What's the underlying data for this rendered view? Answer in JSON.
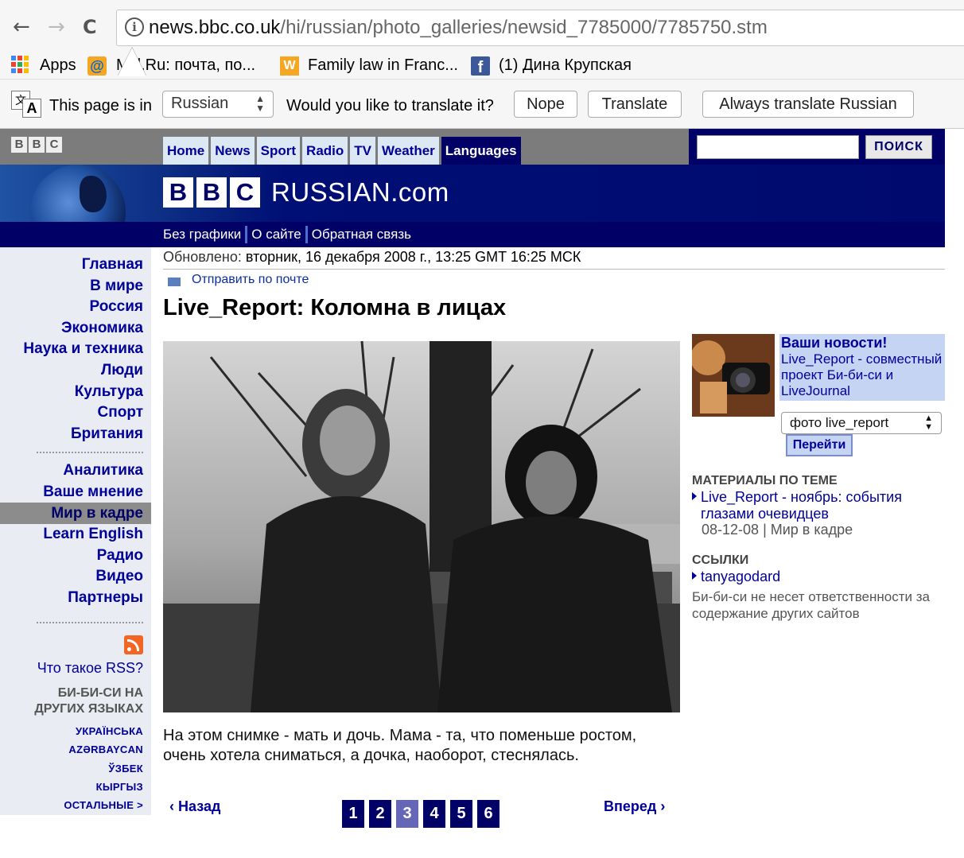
{
  "browser": {
    "back_glyph": "←",
    "forward_glyph": "→",
    "reload_glyph": "C",
    "info_glyph": "i",
    "url_host": "news.bbc.co.uk",
    "url_path": "/hi/russian/photo_galleries/newsid_7785000/7785750.stm",
    "bookmarks": {
      "apps": "Apps",
      "mail": "M   il.Ru: почта, по...",
      "family": "Family law in Franc...",
      "fb": "(1) Дина Крупская"
    },
    "icons": {
      "mail": "@",
      "family": "W",
      "fb": "f"
    }
  },
  "translate": {
    "icon_a": "文",
    "icon_b": "A",
    "intro": "This page is in",
    "language": "Russian",
    "question": "Would you like to translate it?",
    "nope": "Nope",
    "translate": "Translate",
    "always": "Always translate Russian"
  },
  "bbc": {
    "logo_letters": [
      "B",
      "B",
      "C"
    ],
    "tabs": [
      "Home",
      "News",
      "Sport",
      "Radio",
      "TV",
      "Weather",
      "Languages"
    ],
    "search_button": "ПОИСК",
    "brand_text": "RUSSIAN.com",
    "subnav": [
      "Без графики",
      "О сайте",
      "Обратная связь"
    ]
  },
  "leftnav": {
    "items": [
      "Главная",
      "В мире",
      "Россия",
      "Экономика",
      "Наука и техника",
      "Люди",
      "Культура",
      "Спорт",
      "Британия"
    ],
    "items2": [
      "Аналитика",
      "Ваше мнение",
      "Мир в кадре",
      "Learn English",
      "Радио",
      "Видео",
      "Партнеры"
    ],
    "rss_label": "Что такое RSS?",
    "other_langs_title": "БИ-БИ-СИ НА ДРУГИХ ЯЗЫКАХ",
    "langs": [
      "УКРАЇНСЬКА",
      "AZƏRBAYCAN",
      "ЎЗБЕК",
      "КЫРГЫЗ",
      "ОСТАЛЬНЫЕ >"
    ]
  },
  "article": {
    "updated_label": "Обновлено:",
    "updated_value": "вторник, 16 декабря 2008 г., 13:25 GMT 16:25 МСК",
    "email": "Отправить по почте",
    "headline": "Live_Report: Коломна в лицах",
    "caption": "На этом снимке - мать и дочь. Мама - та, что поменьше ростом, очень хотела сниматься, а дочка, наоборот, стеснялась.",
    "prev": "Назад",
    "next": "Вперед",
    "pages": [
      "1",
      "2",
      "3",
      "4",
      "5",
      "6"
    ],
    "current_page": "3"
  },
  "sidebar": {
    "promo_title": "Ваши новости!",
    "promo_text": "Live_Report - совместный проект Би-би-си и LiveJournal",
    "select_value": "фото live_report",
    "go_button": "Перейти",
    "related_head": "МАТЕРИАЛЫ ПО ТЕМЕ",
    "related_link": "Live_Report - ноябрь: события глазами очевидцев",
    "related_date": "08-12-08",
    "related_section": "Мир в кадре",
    "links_head": "ССЫЛКИ",
    "links_link": "tanyagodard",
    "disclaimer": "Би-би-си не несет ответственности за содержание других сайтов"
  }
}
